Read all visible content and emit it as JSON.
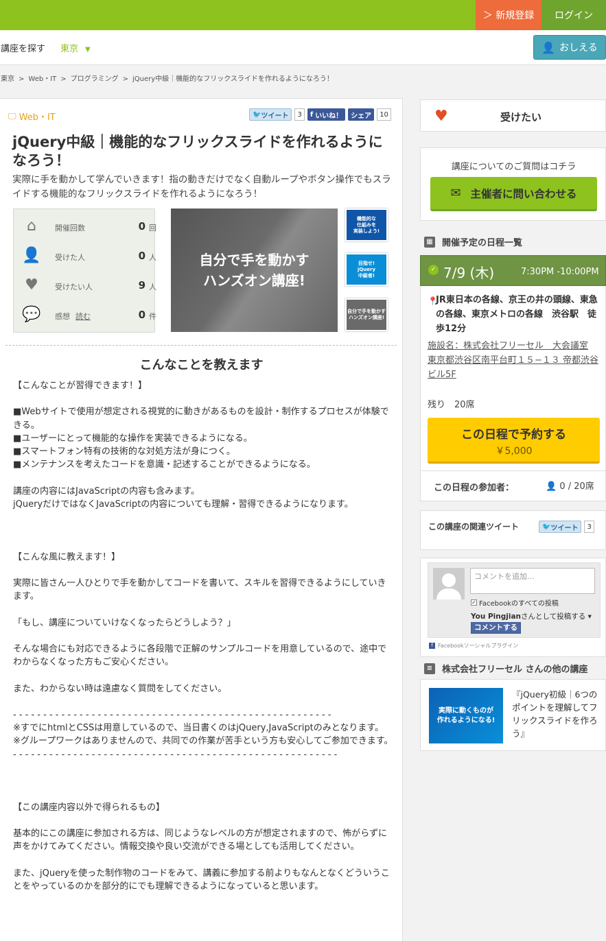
{
  "header": {
    "register_label": "＞ 新規登録",
    "login_label": "ログイン"
  },
  "subheader": {
    "find_label": "講座を探す",
    "region": "東京",
    "region_caret": "▼",
    "teach_label": "おしえる"
  },
  "breadcrumb": [
    "東京",
    "Web・IT",
    "プログラミング",
    "jQuery中級｜機能的なフリックスライドを作れるようになろう！"
  ],
  "breadcrumb_sep": ">",
  "course": {
    "category": "Web・IT",
    "tweet_label": "ツイート",
    "tweet_count": "3",
    "like_label": "いいね！",
    "share_label": "シェア",
    "share_count": "10",
    "title": "jQuery中級｜機能的なフリックスライドを作れるようになろう！",
    "lead": "実際に手を動かして学んでいきます！指の動きだけでなく自動ループやボタン操作でもスライドする機能的なフリックスライドを作れるようになろう！",
    "stats": [
      {
        "label": "開催回数",
        "value": "0",
        "unit": "回",
        "icon": "house-icon"
      },
      {
        "label": "受けた人",
        "value": "0",
        "unit": "人",
        "icon": "person-icon"
      },
      {
        "label": "受けたい人",
        "value": "9",
        "unit": "人",
        "icon": "heart-icon"
      },
      {
        "label": "感想",
        "link": "読む",
        "value": "0",
        "unit": "件",
        "icon": "speech-bubble-icon"
      }
    ],
    "main_image_text": "自分で手を動かす\nハンズオン講座!",
    "thumbnails": [
      {
        "text": "機能的な\n仕組みを\n実装しよう!",
        "color": "#0f55a8"
      },
      {
        "text": "目指せ!\njQuery\n中級者!",
        "color": "#0b8ed8"
      },
      {
        "text": "自分で手を動かす\nハンズオン講座!",
        "color": "#6a6a6a"
      }
    ],
    "teach_heading": "こんなことを教えます",
    "body": "【こんなことが習得できます！】\n\n■Webサイトで使用が想定される視覚的に動きがあるものを設計・制作するプロセスが体験できる。\n■ユーザーにとって機能的な操作を実装できるようになる。\n■スマートフォン特有の技術的な対処方法が身につく。\n■メンテナンスを考えたコードを意識・記述することができるようになる。\n\n講座の内容にはJavaScriptの内容も含みます。\njQueryだけではなくJavaScriptの内容についても理解・習得できるようになります。\n\n\n\n【こんな風に教えます！】\n\n実際に皆さん一人ひとりで手を動かしてコードを書いて、スキルを習得できるようにしていきます。\n\n「もし、講座についていけなくなったらどうしよう？」\n\nそんな場合にも対応できるように各段階で正解のサンプルコードを用意しているので、途中でわからなくなった方もご安心ください。\n\nまた、わからない時は遠慮なく質問をしてください。\n\n- - - - - - - - - - - - - - - - - - - - - - - - - - - - - - - - - - - - - - - - - - - - - - - - - - - - -\n※すでにhtmlとCSSは用意しているので、当日書くのはjQuery,JavaScriptのみとなります。\n※グループワークはありませんので、共同での作業が苦手という方も安心してご参加できます。\n- - - - - - - - - - - - - - - - - - - - - - - - - - - - - - - - - - - - - - - - - - - - - - - - - - - - - -\n\n\n\n【この講座内容以外で得られるもの】\n\n基本的にこの講座に参加される方は、同じようなレベルの方が想定されますので、怖がらずに声をかけてみてください。情報交換や良い交流ができる場としても活用してください。\n\nまた、jQueryを使った制作物のコードをみて、講義に参加する前よりもなんとなくどういうことをやっているのかを部分的にでも理解できるようになっていると思います。"
  },
  "sidebar": {
    "want_label": "受けたい",
    "inquiry_text": "講座についてのご質問はコチラ",
    "inquiry_button": "主催者に問い合わせる",
    "schedule_heading": "開催予定の日程一覧",
    "date": "7/9 (木)",
    "time": "7:30PM -10:00PM",
    "access": "JR東日本の各線、京王の井の頭線、東急の各線、東京メトロの各線　渋谷駅　徒歩12分",
    "venue": "施設名：株式会社フリーセル　大会議室\n東京都渋谷区南平台町１５−１３ 帝都渋谷ビル5F",
    "remaining": "残り　20席",
    "reserve_label": "この日程で予約する",
    "price": "￥5,000",
    "participants_label": "この日程の参加者：",
    "participants_value": "0 / 20席",
    "tweets_label": "この講座の関連ツイート",
    "tweet_label": "ツイート",
    "tweet_count": "3",
    "fb_placeholder": "コメントを追加...",
    "fb_checkbox": "Facebookのすべての投稿",
    "fb_user": "You Pingjian",
    "fb_as": "さんとして投稿する",
    "fb_post": "コメントする",
    "fb_plugin": "Facebookソーシャルプラグイン",
    "other_heading": "株式会社フリーセル さんの他の講座",
    "other_image_text": "実際に動くものが\n作れるようになる!",
    "other_title": "『jQuery初級｜6つのポイントを理解してフリックスライドを作ろう』"
  },
  "colors": {
    "brand_green": "#8dc21f",
    "register_orange": "#ee6b3b",
    "reserve_yellow": "#ffcc00",
    "date_green": "#6e9444"
  }
}
